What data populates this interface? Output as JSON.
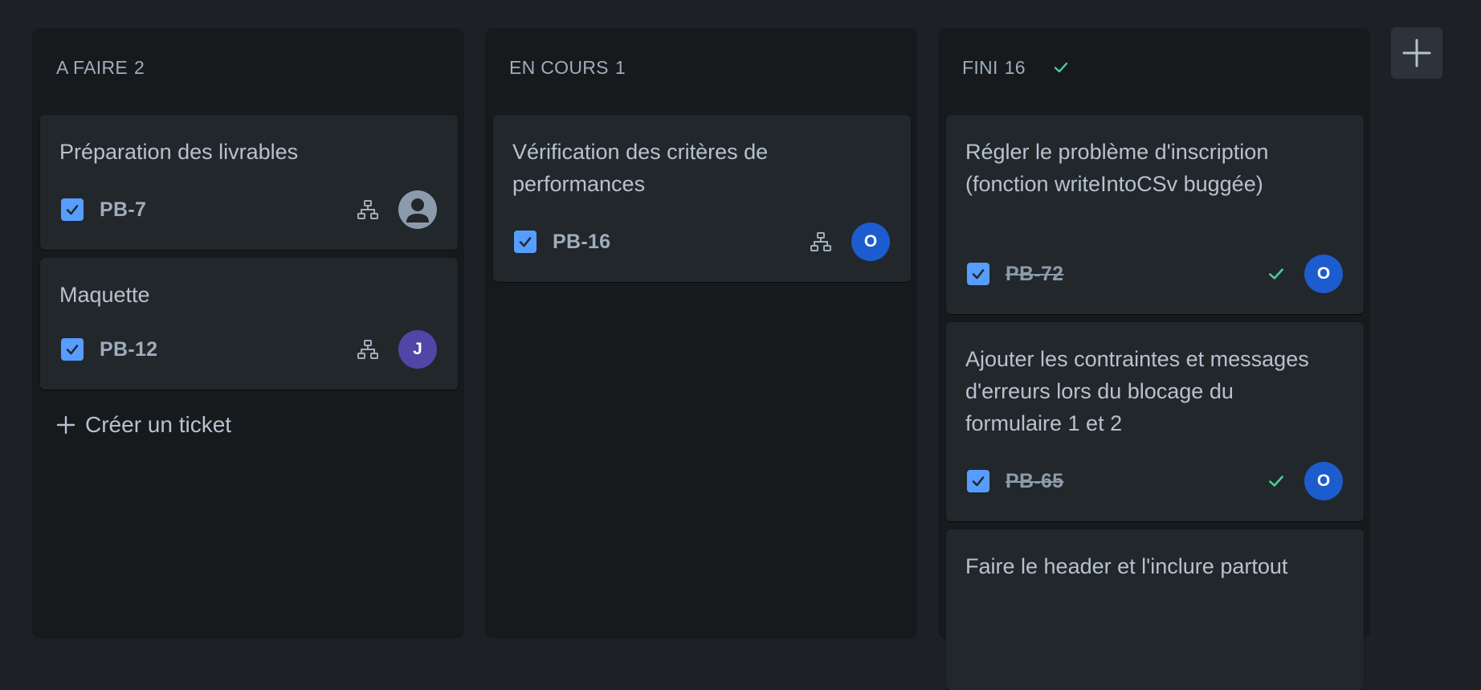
{
  "columns": [
    {
      "name": "A FAIRE",
      "count": "2",
      "cards": [
        {
          "title": "Préparation des livrables",
          "key": "PB-7",
          "assignee_initial": "",
          "assignee_type": "default",
          "done": false
        },
        {
          "title": "Maquette",
          "key": "PB-12",
          "assignee_initial": "J",
          "assignee_type": "j",
          "done": false
        }
      ],
      "create_label": "Créer un ticket"
    },
    {
      "name": "EN COURS",
      "count": "1",
      "cards": [
        {
          "title": "Vérification des critères de performances",
          "key": "PB-16",
          "assignee_initial": "O",
          "assignee_type": "o",
          "done": false
        }
      ]
    },
    {
      "name": "FINI",
      "count": "16",
      "done_icon": "check-icon",
      "cards": [
        {
          "title": "Régler le problème d'inscription (fonction writeIntoCSv buggée)",
          "key": "PB-72",
          "assignee_initial": "O",
          "assignee_type": "o",
          "done": true
        },
        {
          "title": "Ajouter les contraintes et messages d'erreurs lors du blocage du formulaire 1 et 2",
          "key": "PB-65",
          "assignee_initial": "O",
          "assignee_type": "o",
          "done": true
        },
        {
          "title": "Faire le header et l'inclure partout",
          "key": "",
          "assignee_initial": "",
          "assignee_type": "",
          "done": true
        }
      ]
    }
  ],
  "icons": {
    "checkbox": "checkbox-checked-icon",
    "subtask": "hierarchy-icon",
    "done": "check-icon",
    "create": "plus-icon",
    "add_column": "plus-icon",
    "default_avatar": "user-silhouette-icon"
  },
  "colors": {
    "background": "#1d2125",
    "column": "#161a1d",
    "card": "#22272b",
    "checkbox": "#579dff",
    "done_green": "#4bce97",
    "avatar_o": "#1d5cce",
    "avatar_j": "#5245a6"
  }
}
